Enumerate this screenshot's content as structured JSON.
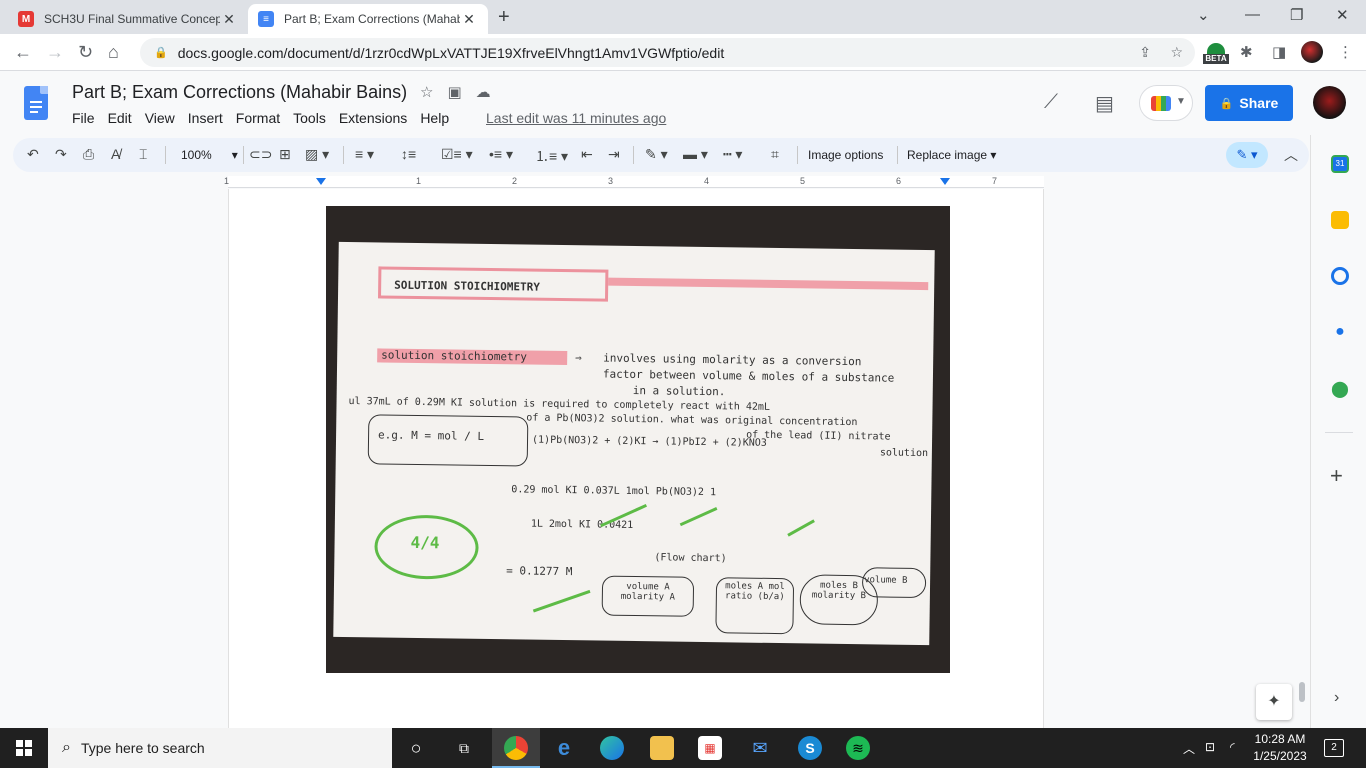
{
  "browser": {
    "tabs": [
      {
        "title": "SCH3U Final Summative Concept",
        "favicon_color": "#e53935",
        "favicon_glyph": "M"
      },
      {
        "title": "Part B; Exam Corrections (Mahab",
        "favicon_color": "#4285f4",
        "favicon_glyph": "≡"
      }
    ],
    "url": "docs.google.com/document/d/1rzr0cdWpLxVATTJE19XfrveElVhngt1Amv1VGWfptio/edit",
    "beta_label": "BETA"
  },
  "doc": {
    "title": "Part B; Exam Corrections (Mahabir Bains)",
    "menu": [
      "File",
      "Edit",
      "View",
      "Insert",
      "Format",
      "Tools",
      "Extensions",
      "Help"
    ],
    "last_edit": "Last edit was 11 minutes ago",
    "share_label": "Share"
  },
  "toolbar": {
    "zoom": "100%",
    "image_options": "Image options",
    "replace_image": "Replace image"
  },
  "ruler": [
    "1",
    "1",
    "2",
    "3",
    "4",
    "5",
    "6",
    "7"
  ],
  "notes": {
    "heading": "SOLUTION STOICHIOMETRY",
    "term": "solution stoichiometry",
    "def1": "involves using molarity as a conversion",
    "def2": "factor between volume & moles of a substance",
    "def3": "in a solution.",
    "q1": "ul 37mL of 0.29M KI solution is required to completely react with 42mL",
    "q2": "of a Pb(NO3)2 solution. what was original concentration",
    "q3": "of the lead (II) nitrate",
    "q4": "solution",
    "eg": "e.g. M = mol / L",
    "rxn": "(1)Pb(NO3)2 + (2)KI → (1)PbI2 + (2)KNO3",
    "calc1": "0.29 mol KI   0.037L   1mol Pb(NO3)2     1",
    "calc2": "1L                     2mol KI        0.0421",
    "answer": "= 0.1277 M",
    "score": "4/4",
    "flow_title": "(Flow chart)",
    "flow_a": "volume A molarity A",
    "flow_ratio": "moles A mol ratio (b/a)",
    "flow_b": "moles B molarity B",
    "flow_vb": "volume B"
  },
  "taskbar": {
    "search_placeholder": "Type here to search",
    "time": "10:28 AM",
    "date": "1/25/2023",
    "notifications": "2"
  }
}
